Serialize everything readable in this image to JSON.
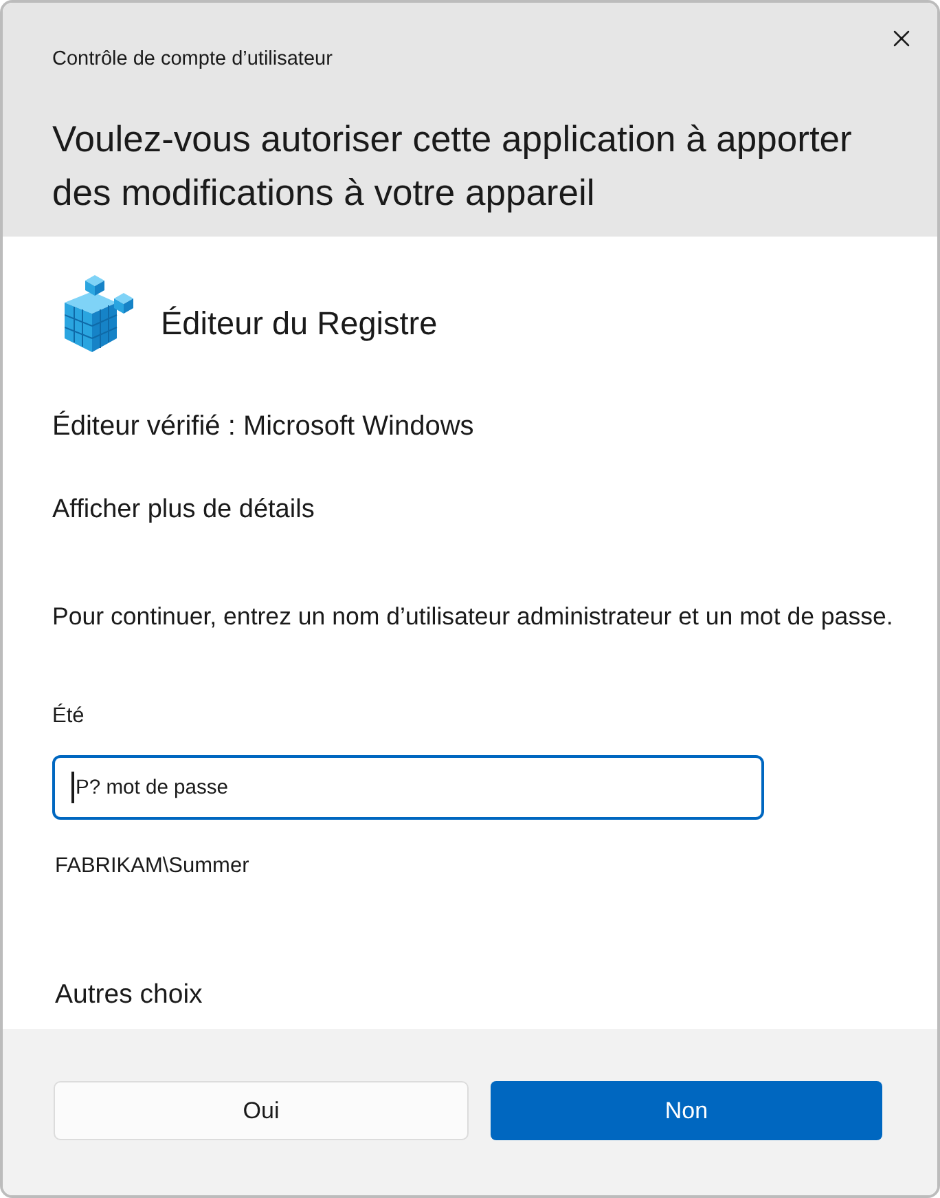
{
  "window": {
    "title": "Contrôle de compte d’utilisateur"
  },
  "heading": "Voulez-vous autoriser cette application à apporter des modifications à votre appareil",
  "app": {
    "name": "Éditeur du Registre"
  },
  "publisher": "Éditeur vérifié : Microsoft Windows",
  "details_link": "Afficher plus de détails",
  "instruction": "Pour continuer, entrez un nom d’utilisateur administrateur et un mot de passe.",
  "account": {
    "label": "Été",
    "password_field": {
      "placeholder": "P? mot de passe",
      "focused": true
    },
    "domain_user": "FABRIKAM\\Summer"
  },
  "other_choices": "Autres choix",
  "buttons": [
    {
      "label": "Oui",
      "primary": false
    },
    {
      "label": "Non",
      "primary": true
    }
  ]
}
